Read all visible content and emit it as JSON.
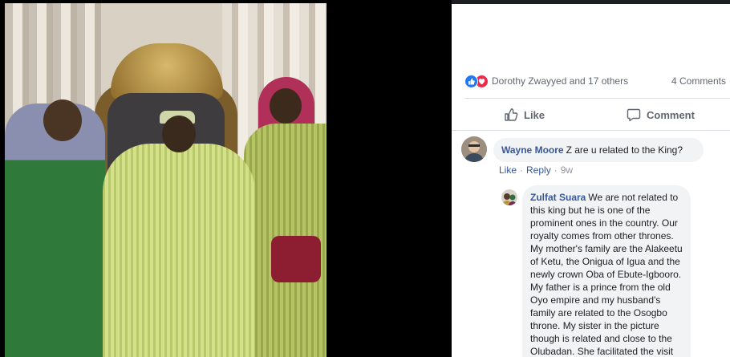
{
  "post": {
    "reactions": {
      "icons": [
        "like-icon",
        "love-icon"
      ],
      "summary": "Dorothy Zwayyed and 17 others"
    },
    "comments_count": "4 Comments",
    "actions": {
      "like_label": "Like",
      "comment_label": "Comment"
    }
  },
  "comments": [
    {
      "author": "Wayne Moore",
      "text": "Z are u related to the King?",
      "like_label": "Like",
      "reply_label": "Reply",
      "time": "9w"
    }
  ],
  "reply": {
    "author": "Zulfat Suara",
    "text": "We are not related to this king but he is one of the prominent ones in the country. Our royalty comes from other thrones. My mother's family are the Alakeetu of Ketu, the Onigua of Igua and the newly crown Oba of Ebute-Igbooro. My father is a prince from the old Oyo empire and my husband's family are related to the Osogbo throne. My sister in the picture though is related and close to the Olubadan. She facilitated the visit"
  },
  "colors": {
    "link_blue": "#385898",
    "like_blue": "#2078f4",
    "love_red": "#f0284a",
    "bubble_gray": "#f2f3f5",
    "meta_gray": "#616770"
  }
}
